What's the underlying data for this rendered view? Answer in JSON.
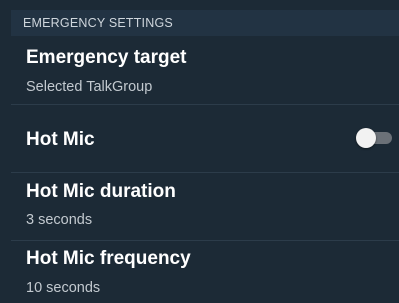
{
  "section": {
    "header": "EMERGENCY SETTINGS"
  },
  "settings": [
    {
      "title": "Emergency target",
      "subtitle": "Selected TalkGroup"
    },
    {
      "title": "Hot Mic",
      "toggle_on": false
    },
    {
      "title": "Hot Mic duration",
      "subtitle": "3 seconds"
    },
    {
      "title": "Hot Mic frequency",
      "subtitle": "10 seconds"
    }
  ],
  "colors": {
    "background": "#1c2a36",
    "header_background": "#223343",
    "divider": "#2c3c4a",
    "toggle_track_off": "#6b7178",
    "toggle_thumb": "#f2f2f2"
  }
}
